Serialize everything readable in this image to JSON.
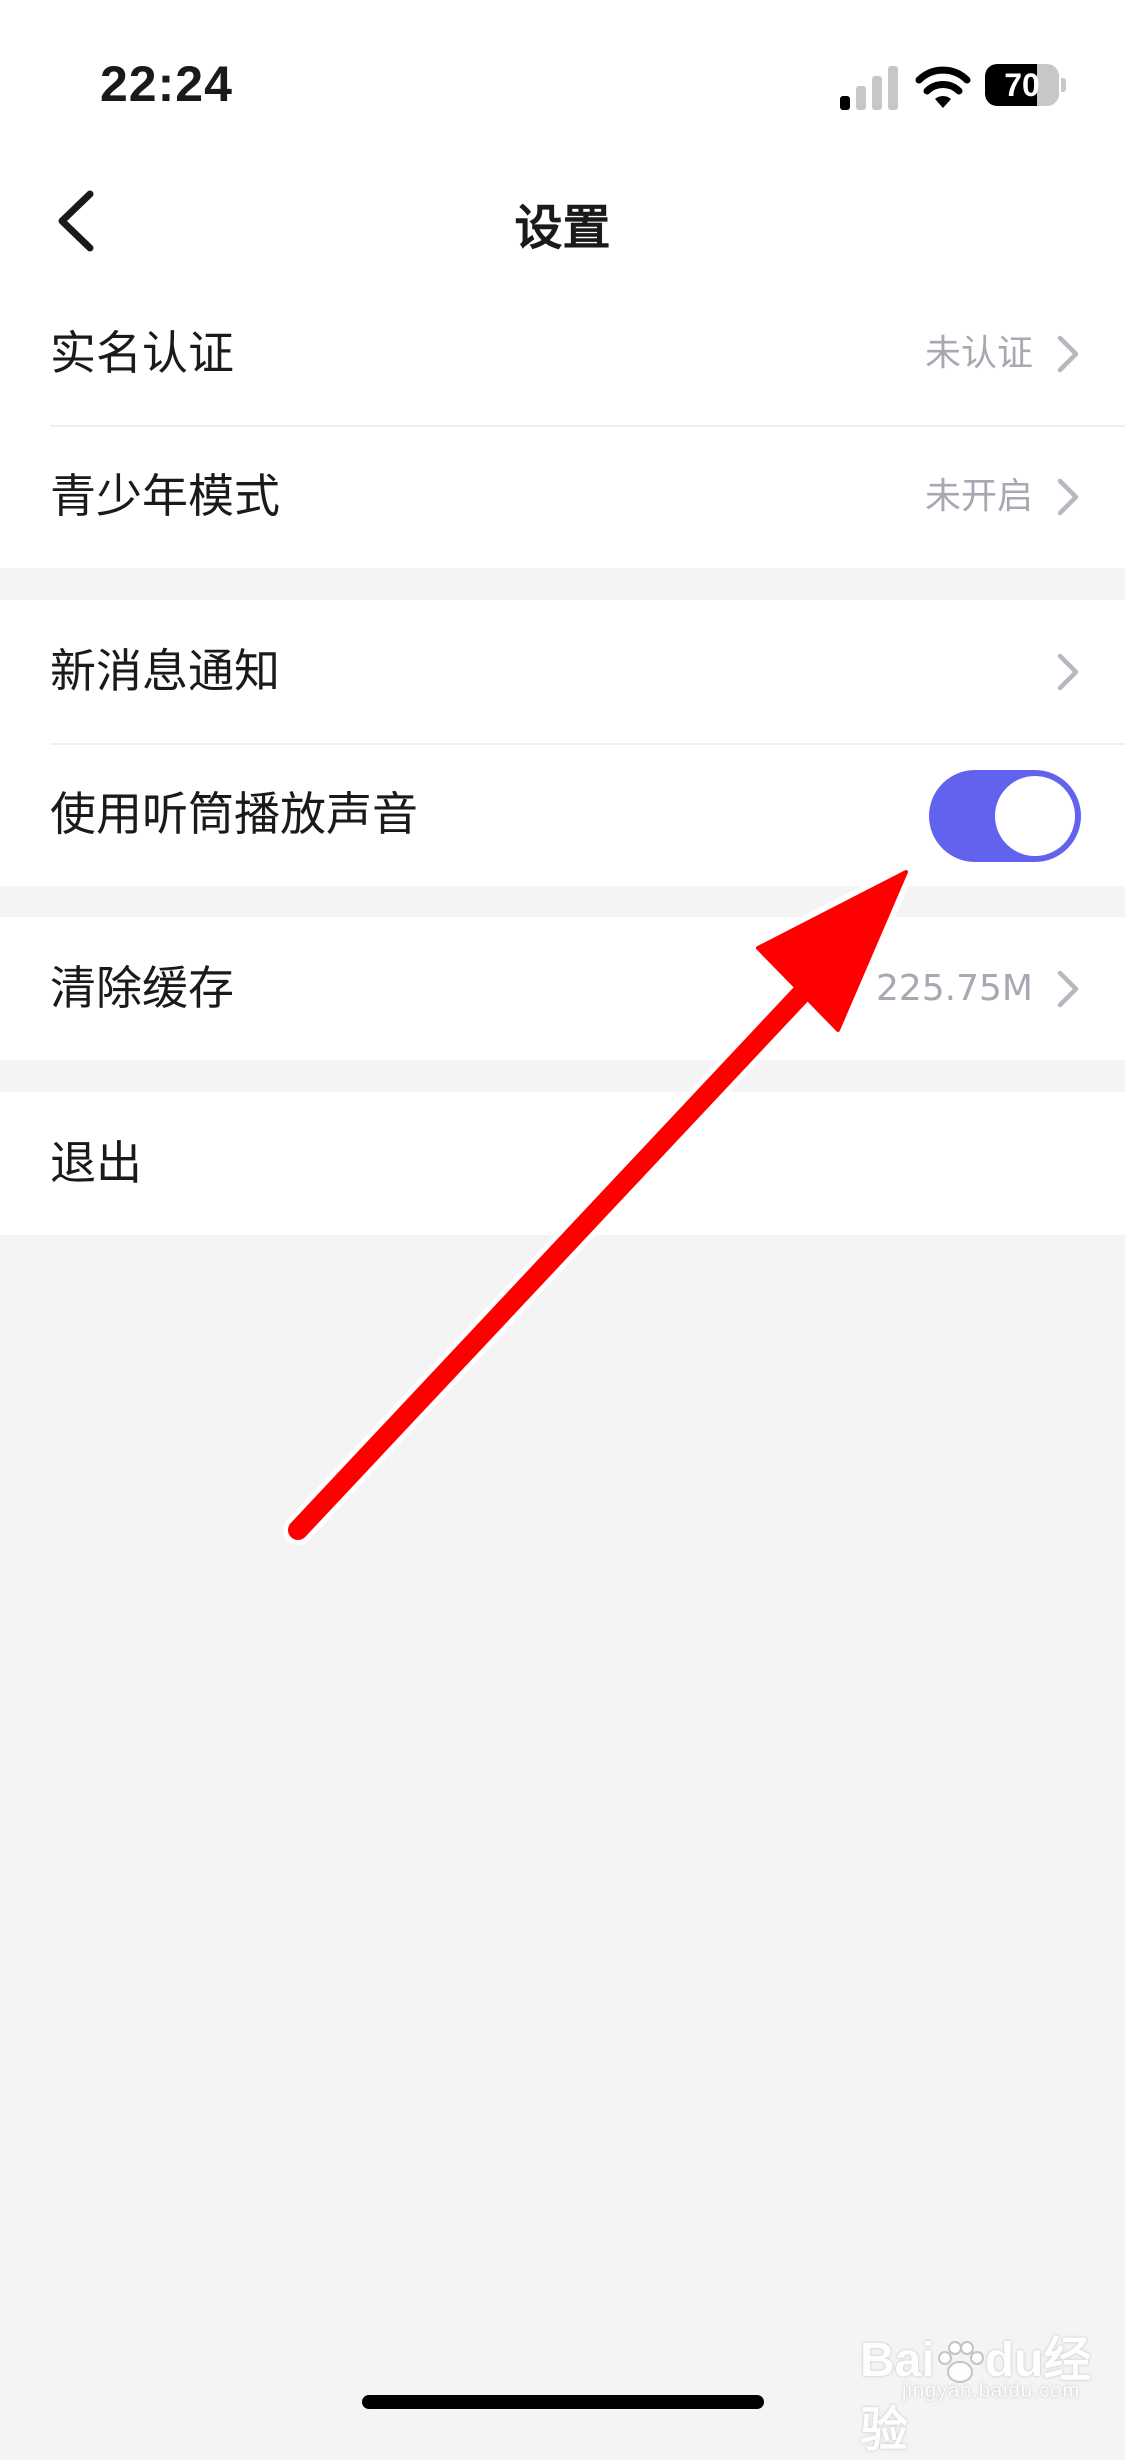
{
  "status_bar": {
    "time": "22:24",
    "battery_level": "70",
    "battery_fraction": 0.7,
    "icons": [
      "signal-icon",
      "wifi-icon",
      "battery-icon"
    ]
  },
  "header": {
    "title": "设置",
    "back_icon": "chevron-left-icon"
  },
  "groups": [
    {
      "rows": [
        {
          "label": "实名认证",
          "value": "未认证",
          "icon": "chevron-right-icon"
        },
        {
          "label": "青少年模式",
          "value": "未开启",
          "icon": "chevron-right-icon"
        }
      ]
    },
    {
      "rows": [
        {
          "label": "新消息通知",
          "icon": "chevron-right-icon"
        },
        {
          "label": "使用听筒播放声音",
          "toggle": true
        }
      ]
    },
    {
      "rows": [
        {
          "label": "清除缓存",
          "value": "225.75M",
          "icon": "chevron-right-icon"
        }
      ]
    },
    {
      "rows": [
        {
          "label": "退出"
        }
      ]
    }
  ],
  "watermark": {
    "brand": "Bai",
    "brand_suffix": "du",
    "product": "经验",
    "url": "jingyan.baidu.com"
  },
  "colors": {
    "accent_toggle": "#6262ef",
    "annotation_arrow": "#ff0000",
    "page_background": "#f4f4f4",
    "secondary_text": "#a6a9b1"
  }
}
